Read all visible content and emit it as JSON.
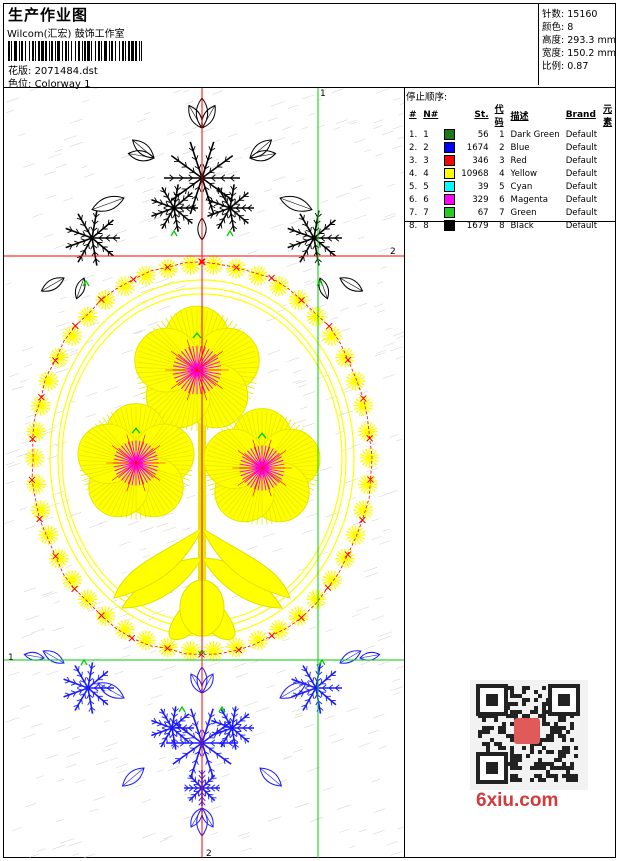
{
  "header": {
    "title": "生产作业图",
    "company": "Wilcom(汇宏) 鼓饰工作室",
    "design_label": "花版:",
    "design_value": "2071484.dst",
    "colorway_label": "色位:",
    "colorway_value": "Colorway 1"
  },
  "stats": [
    {
      "label": "针数:",
      "value": "15160"
    },
    {
      "label": "颜色:",
      "value": "8"
    },
    {
      "label": "高度:",
      "value": "293.3 mm"
    },
    {
      "label": "宽度:",
      "value": "150.2 mm"
    },
    {
      "label": "比例:",
      "value": "0.87"
    }
  ],
  "stop_sequence": {
    "title": "停止顺序:",
    "headers": [
      "#",
      "N#",
      "St.",
      "代码",
      "描述",
      "Brand",
      "元素"
    ],
    "rows": [
      {
        "idx": "1.",
        "n": "1",
        "color": "#1a7a1a",
        "st": "56",
        "code": "1",
        "desc": "Dark Green",
        "brand": "Default"
      },
      {
        "idx": "2.",
        "n": "2",
        "color": "#0000ff",
        "st": "1674",
        "code": "2",
        "desc": "Blue",
        "brand": "Default"
      },
      {
        "idx": "3.",
        "n": "3",
        "color": "#ff0000",
        "st": "346",
        "code": "3",
        "desc": "Red",
        "brand": "Default"
      },
      {
        "idx": "4.",
        "n": "4",
        "color": "#ffff00",
        "st": "10968",
        "code": "4",
        "desc": "Yellow",
        "brand": "Default"
      },
      {
        "idx": "5.",
        "n": "5",
        "color": "#00ffff",
        "st": "39",
        "code": "5",
        "desc": "Cyan",
        "brand": "Default"
      },
      {
        "idx": "6.",
        "n": "6",
        "color": "#ff00ff",
        "st": "329",
        "code": "6",
        "desc": "Magenta",
        "brand": "Default"
      },
      {
        "idx": "7.",
        "n": "7",
        "color": "#22cc22",
        "st": "67",
        "code": "7",
        "desc": "Green",
        "brand": "Default"
      },
      {
        "idx": "8.",
        "n": "8",
        "color": "#000000",
        "st": "1679",
        "code": "8",
        "desc": "Black",
        "brand": "Default"
      }
    ]
  },
  "guides": {
    "v1": "1",
    "h2": "2",
    "h1": "1",
    "v2": "2"
  },
  "watermark": "6xiu.com",
  "colors": {
    "yellow": "#ffff00",
    "blue": "#1a1aff",
    "red": "#ff0000",
    "black": "#000000",
    "magenta": "#ff00ff",
    "green": "#00cc00",
    "guide_red": "#ff0000",
    "guide_green": "#00cc00"
  }
}
